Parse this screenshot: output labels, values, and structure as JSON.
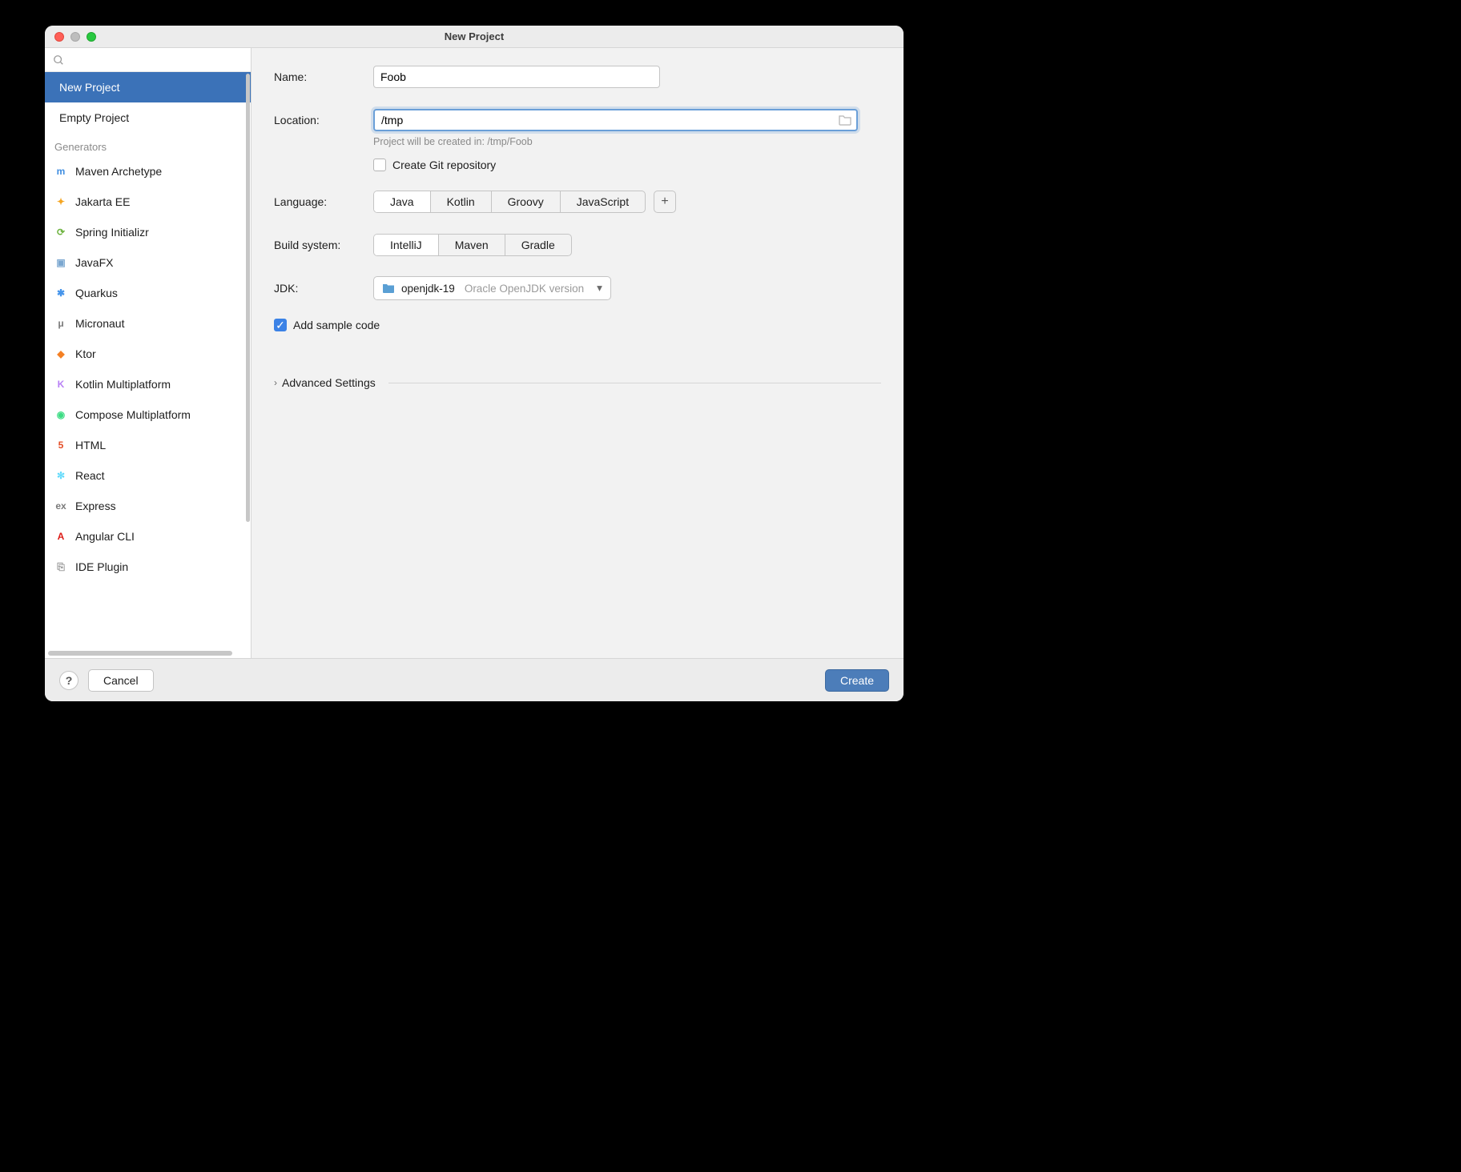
{
  "window": {
    "title": "New Project"
  },
  "sidebar": {
    "search_placeholder": "",
    "top_items": [
      {
        "label": "New Project",
        "selected": true
      },
      {
        "label": "Empty Project",
        "selected": false
      }
    ],
    "generators_header": "Generators",
    "generators": [
      {
        "label": "Maven Archetype",
        "icon_color": "#3f8de0",
        "icon_text": "m"
      },
      {
        "label": "Jakarta EE",
        "icon_color": "#f5a623",
        "icon_text": "✦"
      },
      {
        "label": "Spring Initializr",
        "icon_color": "#6db33f",
        "icon_text": "⟳"
      },
      {
        "label": "JavaFX",
        "icon_color": "#7ba7d0",
        "icon_text": "▣"
      },
      {
        "label": "Quarkus",
        "icon_color": "#4695eb",
        "icon_text": "✱"
      },
      {
        "label": "Micronaut",
        "icon_color": "#7a7a7a",
        "icon_text": "μ"
      },
      {
        "label": "Ktor",
        "icon_color": "#f48024",
        "icon_text": "◆"
      },
      {
        "label": "Kotlin Multiplatform",
        "icon_color": "#b880f5",
        "icon_text": "K"
      },
      {
        "label": "Compose Multiplatform",
        "icon_color": "#3ddc84",
        "icon_text": "◉"
      },
      {
        "label": "HTML",
        "icon_color": "#e44d26",
        "icon_text": "5"
      },
      {
        "label": "React",
        "icon_color": "#61dafb",
        "icon_text": "✻"
      },
      {
        "label": "Express",
        "icon_color": "#7a7a7a",
        "icon_text": "ex"
      },
      {
        "label": "Angular CLI",
        "icon_color": "#dd1b16",
        "icon_text": "A"
      },
      {
        "label": "IDE Plugin",
        "icon_color": "#9a9a9a",
        "icon_text": "⎘"
      }
    ]
  },
  "form": {
    "name_label": "Name:",
    "name_value": "Foob",
    "location_label": "Location:",
    "location_value": "/tmp",
    "location_hint": "Project will be created in: /tmp/Foob",
    "git_label": "Create Git repository",
    "git_checked": false,
    "language_label": "Language:",
    "languages": [
      "Java",
      "Kotlin",
      "Groovy",
      "JavaScript"
    ],
    "language_selected": 0,
    "build_label": "Build system:",
    "build_systems": [
      "IntelliJ",
      "Maven",
      "Gradle"
    ],
    "build_selected": 0,
    "jdk_label": "JDK:",
    "jdk_value": "openjdk-19",
    "jdk_desc": "Oracle OpenJDK version",
    "sample_label": "Add sample code",
    "sample_checked": true,
    "advanced_label": "Advanced Settings"
  },
  "footer": {
    "cancel": "Cancel",
    "create": "Create"
  }
}
